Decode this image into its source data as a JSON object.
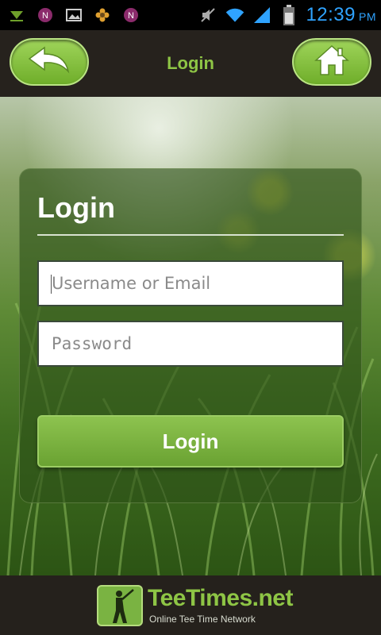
{
  "status_bar": {
    "time": "12:39",
    "ampm": "PM",
    "icons": [
      "download-icon",
      "notification-n-icon",
      "image-icon",
      "flower-icon",
      "notification-n-icon",
      "mute-icon",
      "wifi-icon",
      "signal-icon",
      "battery-icon"
    ]
  },
  "header": {
    "title": "Login",
    "back_icon": "back-arrow-icon",
    "home_icon": "home-icon"
  },
  "card": {
    "title": "Login",
    "username": {
      "value": "",
      "placeholder": "Username or Email"
    },
    "password": {
      "value": "",
      "placeholder": "Password"
    },
    "login_label": "Login"
  },
  "footer": {
    "logo_name": "TeeTimes.net",
    "logo_tagline": "Online Tee Time Network"
  },
  "colors": {
    "accent_green": "#8ec545",
    "button_green": "#7ab342",
    "status_blue": "#2fa3ff",
    "dark_bar": "#26221d"
  }
}
